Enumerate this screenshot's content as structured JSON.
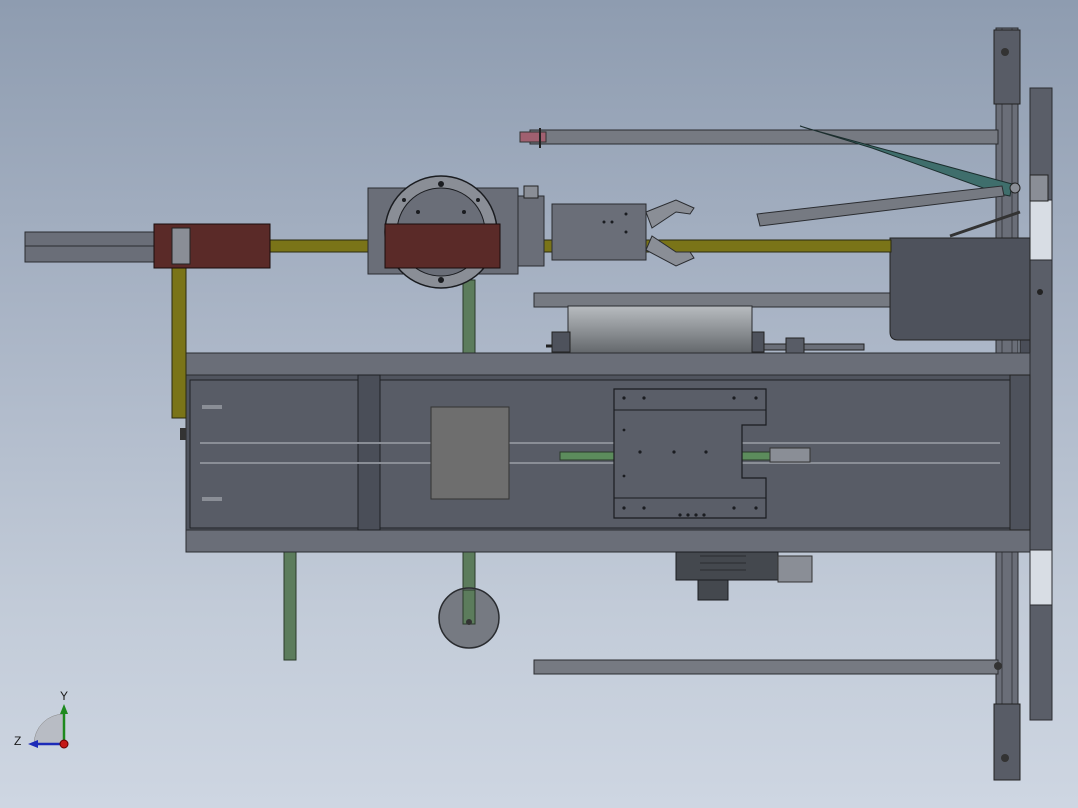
{
  "viewport": {
    "background_top": "#8e9cb0",
    "background_bottom": "#ced6e2"
  },
  "triad": {
    "y_label": "Y",
    "z_label": "Z",
    "y_color": "#1e8a1e",
    "z_color": "#1c2bb8",
    "x_color": "#c41818"
  },
  "colors": {
    "frame_dark": "#4e525c",
    "frame_mid": "#6a6e78",
    "frame_light": "#8a8e96",
    "rail_olive": "#6e6a14",
    "carriage_maroon": "#5a2a28",
    "green_rod": "#5c7c5c",
    "teal_arm": "#3f6e6c",
    "roller_grey": "#9a9ea2"
  }
}
